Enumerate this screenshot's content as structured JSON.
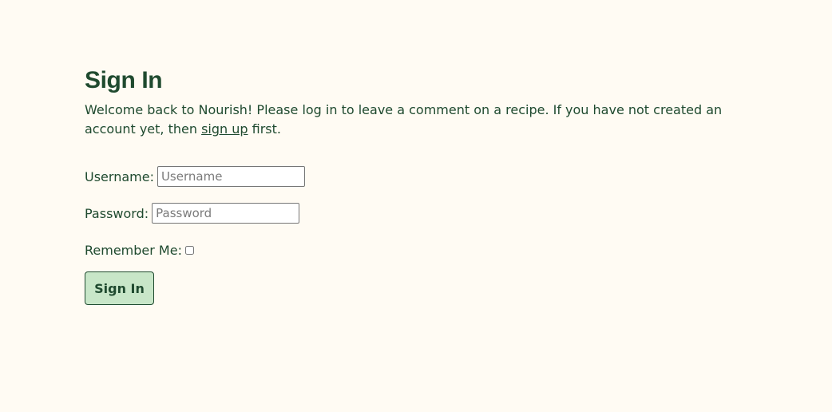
{
  "page": {
    "title": "Sign In",
    "intro_before": "Welcome back to Nourish! Please log in to leave a comment on a recipe. If you have not created an account yet, then ",
    "signup_link": "sign up",
    "intro_after": " first."
  },
  "form": {
    "username_label": "Username:",
    "username_placeholder": "Username",
    "username_value": "",
    "password_label": "Password:",
    "password_placeholder": "Password",
    "password_value": "",
    "remember_label": "Remember Me:",
    "remember_checked": false,
    "submit_label": "Sign In"
  },
  "colors": {
    "background": "#fffbf3",
    "text": "#1f4a2f",
    "button_bg": "#c8e6c8"
  }
}
